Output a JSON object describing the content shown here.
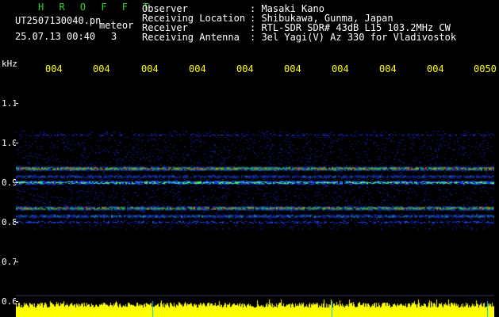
{
  "header": {
    "brand": "H R O F F T",
    "filename": "UT2507130040.pn",
    "meteor_label": "meteor",
    "timestamp": "25.07.13 00:40",
    "count": "3"
  },
  "info": [
    {
      "label": "Observer",
      "value": ": Masaki Kano"
    },
    {
      "label": "Receiving Location",
      "value": ": Shibukawa, Gunma, Japan"
    },
    {
      "label": "Receiver",
      "value": ": RTL-SDR SDR# 43dB L15 103.2MHz CW"
    },
    {
      "label": "Receiving Antenna",
      "value": ": 3el Yagi(V) Az 330 for Vladivostok"
    }
  ],
  "x_axis": {
    "ticks": [
      "004",
      "004",
      "004",
      "004",
      "004",
      "004",
      "004",
      "004",
      "004",
      "0050"
    ]
  },
  "y_axis": {
    "unit": "kHz",
    "ticks": [
      "1.1",
      "1.0",
      "0.9",
      "0.8",
      "0.7",
      "0.6"
    ],
    "range": [
      0.6,
      1.15
    ]
  },
  "spectrogram": {
    "bands_khz": [
      {
        "center": 1.02,
        "strength": 0.35
      },
      {
        "center": 0.935,
        "strength": 0.95
      },
      {
        "center": 0.915,
        "strength": 0.5
      },
      {
        "center": 0.9,
        "strength": 0.75
      },
      {
        "center": 0.835,
        "strength": 0.9
      },
      {
        "center": 0.815,
        "strength": 0.6
      },
      {
        "center": 0.8,
        "strength": 0.4
      }
    ]
  },
  "colors": {
    "background": "#000000",
    "label_text": "#ffffff",
    "brand": "#2fd12f",
    "ticks": "#ffff00",
    "power_bar": "#ffff00"
  }
}
